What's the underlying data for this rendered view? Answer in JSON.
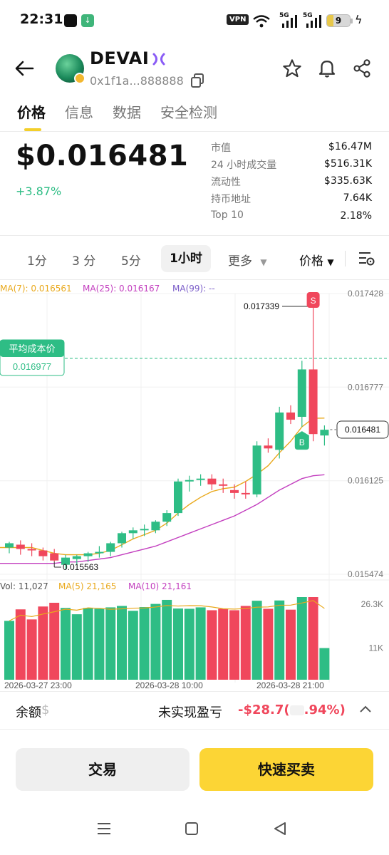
{
  "status_bar": {
    "time": "22:31",
    "vpn": "VPN",
    "signal_1": "5G",
    "signal_2": "5G",
    "battery": "9"
  },
  "header": {
    "token_name": "DEVAI",
    "address": "0x1f1a...888888"
  },
  "tabs": [
    {
      "label": "价格",
      "active": true
    },
    {
      "label": "信息",
      "active": false
    },
    {
      "label": "数据",
      "active": false
    },
    {
      "label": "安全检测",
      "active": false
    }
  ],
  "price": {
    "value": "$0.016481",
    "change": "+3.87%"
  },
  "stats": [
    {
      "label": "市值",
      "value": "$16.47M"
    },
    {
      "label": "24 小时成交量",
      "value": "$516.31K"
    },
    {
      "label": "流动性",
      "value": "$335.63K"
    },
    {
      "label": "持币地址",
      "value": "7.64K"
    },
    {
      "label": "Top 10",
      "value": "2.18%"
    }
  ],
  "intervals": {
    "items": [
      "1分",
      "3 分",
      "5分",
      "1小时"
    ],
    "active": "1小时",
    "more": "更多",
    "price_toggle": "价格"
  },
  "ma_legend": {
    "ma7": "MA(7): 0.016561",
    "ma25": "MA(25): 0.016167",
    "ma99": "MA(99): --"
  },
  "vol_legend": {
    "vol": "Vol: 11,027",
    "ma5": "MA(5) 21,165",
    "ma10": "MA(10) 21,161"
  },
  "colors": {
    "up": "#2ebd85",
    "down": "#f0475c",
    "ma7": "#e9a91c",
    "ma25": "#c33fbf",
    "ma99": "#7a5cc8",
    "accent": "#fcd535"
  },
  "chart_data": {
    "type": "candlestick",
    "interval": "1小时",
    "price_axis_labels": [
      "0.017428",
      "0.016777",
      "0.016125",
      "0.015474"
    ],
    "price_ylim": [
      0.015474,
      0.017428
    ],
    "current_price_label": "0.016481",
    "high_annotation": "0.017339",
    "low_annotation": "0.015563",
    "avg_cost": {
      "label": "平均成本价",
      "value": "0.016977"
    },
    "buy_marker": "B",
    "sell_marker": "S",
    "time_labels": [
      "2026-03-27 23:00",
      "2026-03-28 10:00",
      "2026-03-28 21:00"
    ],
    "volume_axis_labels": [
      "26.3K",
      "11K"
    ],
    "candles": [
      {
        "o": 0.01566,
        "h": 0.0157,
        "l": 0.01562,
        "c": 0.01569
      },
      {
        "o": 0.01568,
        "h": 0.01571,
        "l": 0.01561,
        "c": 0.01565
      },
      {
        "o": 0.01565,
        "h": 0.01569,
        "l": 0.0156,
        "c": 0.01564
      },
      {
        "o": 0.01564,
        "h": 0.01566,
        "l": 0.01557,
        "c": 0.0156
      },
      {
        "o": 0.01562,
        "h": 0.01565,
        "l": 0.015563,
        "c": 0.01557
      },
      {
        "o": 0.01554,
        "h": 0.01561,
        "l": 0.01551,
        "c": 0.01559
      },
      {
        "o": 0.01558,
        "h": 0.01561,
        "l": 0.01554,
        "c": 0.0156
      },
      {
        "o": 0.0156,
        "h": 0.01563,
        "l": 0.01556,
        "c": 0.01562
      },
      {
        "o": 0.01562,
        "h": 0.01567,
        "l": 0.01559,
        "c": 0.01563
      },
      {
        "o": 0.01563,
        "h": 0.0157,
        "l": 0.0156,
        "c": 0.01569
      },
      {
        "o": 0.01569,
        "h": 0.01577,
        "l": 0.01566,
        "c": 0.01576
      },
      {
        "o": 0.01576,
        "h": 0.0158,
        "l": 0.01572,
        "c": 0.01578
      },
      {
        "o": 0.01578,
        "h": 0.01582,
        "l": 0.01574,
        "c": 0.01579
      },
      {
        "o": 0.01578,
        "h": 0.01585,
        "l": 0.01576,
        "c": 0.01584
      },
      {
        "o": 0.01584,
        "h": 0.01592,
        "l": 0.01581,
        "c": 0.0159
      },
      {
        "o": 0.0159,
        "h": 0.01614,
        "l": 0.01588,
        "c": 0.01612
      },
      {
        "o": 0.01612,
        "h": 0.01616,
        "l": 0.01605,
        "c": 0.01613
      },
      {
        "o": 0.01613,
        "h": 0.01617,
        "l": 0.01609,
        "c": 0.01614
      },
      {
        "o": 0.01614,
        "h": 0.01617,
        "l": 0.01606,
        "c": 0.0161
      },
      {
        "o": 0.0161,
        "h": 0.01614,
        "l": 0.01604,
        "c": 0.01609
      },
      {
        "o": 0.01606,
        "h": 0.0161,
        "l": 0.016,
        "c": 0.01604
      },
      {
        "o": 0.01604,
        "h": 0.01612,
        "l": 0.016,
        "c": 0.01603
      },
      {
        "o": 0.01603,
        "h": 0.0164,
        "l": 0.01601,
        "c": 0.01637
      },
      {
        "o": 0.01637,
        "h": 0.01642,
        "l": 0.01632,
        "c": 0.01635
      },
      {
        "o": 0.01634,
        "h": 0.01664,
        "l": 0.01628,
        "c": 0.0166
      },
      {
        "o": 0.0166,
        "h": 0.01665,
        "l": 0.01652,
        "c": 0.01655
      },
      {
        "o": 0.01657,
        "h": 0.01696,
        "l": 0.0165,
        "c": 0.0169
      },
      {
        "o": 0.0169,
        "h": 0.017339,
        "l": 0.0164,
        "c": 0.01645
      },
      {
        "o": 0.01644,
        "h": 0.01651,
        "l": 0.01637,
        "c": 0.01648
      }
    ],
    "volumes": [
      20500,
      24500,
      21000,
      25500,
      26800,
      25000,
      22800,
      25000,
      24700,
      25200,
      25700,
      24000,
      25300,
      26400,
      27800,
      24800,
      24700,
      25200,
      24200,
      24700,
      24200,
      25700,
      27500,
      24700,
      27600,
      24400,
      29400,
      31700,
      11027
    ],
    "ma7": [
      0.01566,
      0.01566,
      0.01566,
      0.01564,
      0.01562,
      0.01561,
      0.01561,
      0.01561,
      0.01562,
      0.01564,
      0.01568,
      0.01572,
      0.01575,
      0.01578,
      0.01583,
      0.0159,
      0.01596,
      0.01601,
      0.01605,
      0.01607,
      0.01608,
      0.01612,
      0.01617,
      0.01623,
      0.01632,
      0.0164,
      0.0165,
      0.01656,
      0.016561
    ],
    "ma25": [
      0.01555,
      0.01555,
      0.01555,
      0.01555,
      0.01555,
      0.01556,
      0.01556,
      0.01557,
      0.01558,
      0.01559,
      0.01561,
      0.01563,
      0.01565,
      0.01567,
      0.0157,
      0.01573,
      0.01576,
      0.01579,
      0.01582,
      0.01585,
      0.01588,
      0.01592,
      0.01596,
      0.01601,
      0.01606,
      0.0161,
      0.01614,
      0.01616,
      0.016167
    ],
    "vol_ylim": [
      11000,
      26300
    ]
  },
  "bottom": {
    "balance_label": "余额",
    "balance_value": "$",
    "pnl_label": "未实现盈亏",
    "pnl_value": "-$28.7(",
    "pnl_pct": ".94%)",
    "trade_button": "交易",
    "quick_button": "快速买卖"
  }
}
